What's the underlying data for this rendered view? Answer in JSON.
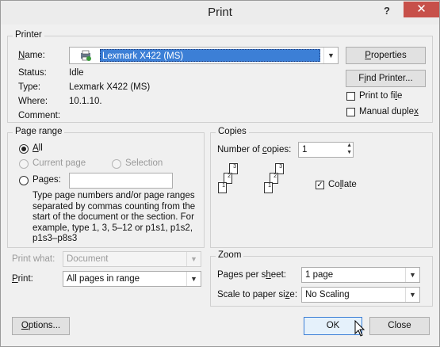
{
  "window": {
    "title": "Print",
    "help": "?",
    "close": "✕"
  },
  "printer": {
    "group_label": "Printer",
    "name_label": "Name:",
    "name_value": "Lexmark X422 (MS)",
    "status_label": "Status:",
    "status_value": "Idle",
    "type_label": "Type:",
    "type_value": "Lexmark X422 (MS)",
    "where_label": "Where:",
    "where_value": "10.1.10.",
    "comment_label": "Comment:",
    "properties_button": "Properties",
    "find_printer_button": "Find Printer...",
    "print_to_file_label": "Print to file",
    "manual_duplex_label": "Manual duplex"
  },
  "page_range": {
    "group_label": "Page range",
    "all_label": "All",
    "current_page_label": "Current page",
    "selection_label": "Selection",
    "pages_label": "Pages:",
    "hint": "Type page numbers and/or page ranges separated by commas counting from the start of the document or the section. For example, type 1, 3, 5–12 or p1s1, p1s2, p1s3–p8s3"
  },
  "copies": {
    "group_label": "Copies",
    "number_label": "Number of copies:",
    "number_value": "1",
    "collate_label": "Collate",
    "collate_checked": true
  },
  "print_what": {
    "label": "Print what:",
    "value": "Document"
  },
  "print": {
    "label": "Print:",
    "value": "All pages in range"
  },
  "zoom": {
    "group_label": "Zoom",
    "pages_per_sheet_label": "Pages per sheet:",
    "pages_per_sheet_value": "1 page",
    "scale_label": "Scale to paper size:",
    "scale_value": "No Scaling"
  },
  "footer": {
    "options_button": "Options...",
    "ok_button": "OK",
    "close_button": "Close"
  }
}
